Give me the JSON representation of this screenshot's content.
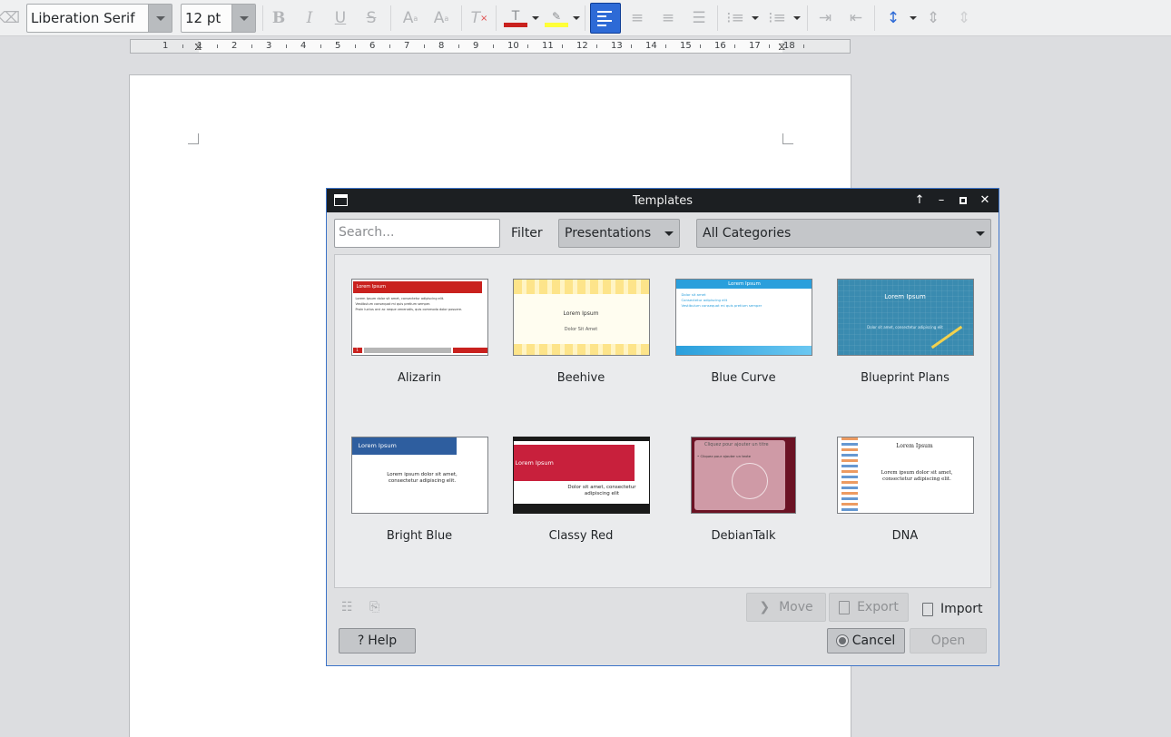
{
  "toolbar": {
    "font_name": "Liberation Serif",
    "font_size": "12 pt",
    "icons": [
      "clear-format-icon",
      "bold-icon",
      "italic-icon",
      "underline-icon",
      "strikethrough-icon",
      "superscript-icon",
      "subscript-icon",
      "clear-direct-format-icon",
      "font-color-icon",
      "highlight-color-icon",
      "align-left-icon",
      "align-center-icon",
      "align-right-icon",
      "justify-icon",
      "unordered-list-icon",
      "ordered-list-icon",
      "increase-indent-icon",
      "decrease-indent-icon",
      "line-spacing-icon",
      "paragraph-spacing-icon"
    ],
    "colors": {
      "font_color": "#c9211e",
      "highlight": "#ffff38",
      "active": "#2d6ad6"
    }
  },
  "ruler": {
    "labels": [
      "1",
      "1",
      "2",
      "3",
      "4",
      "5",
      "6",
      "7",
      "8",
      "9",
      "10",
      "11",
      "12",
      "13",
      "14",
      "15",
      "16",
      "17",
      "18"
    ]
  },
  "dialog": {
    "title": "Templates",
    "search_placeholder": "Search...",
    "filter_label": "Filter",
    "filter_value": "Presentations",
    "category_value": "All Categories",
    "templates": [
      {
        "name": "Alizarin",
        "thumb": {
          "heading": "Lorem Ipsum",
          "lines": [
            "Lorem Ipsum dolor sit amet, consectetur adipiscing elit.",
            "Vestibulum consequat mi quis pretium semper.",
            "Proin luctus orci ac neque venenatis, quis commodo dolor posuere."
          ],
          "page": "1"
        }
      },
      {
        "name": "Beehive",
        "thumb": {
          "heading": "Lorem Ipsum",
          "sub": "Dolor Sit Amet"
        }
      },
      {
        "name": "Blue Curve",
        "thumb": {
          "heading": "Lorem Ipsum",
          "lines": [
            "Dolor sit amet",
            "Consectetur adipiscing elit",
            "Vestibulum consequat mi quis pretium semper"
          ]
        }
      },
      {
        "name": "Blueprint Plans",
        "thumb": {
          "heading": "Lorem Ipsum",
          "sub": "Dolor sit amet, consectetur adipiscing elit"
        }
      },
      {
        "name": "Bright Blue",
        "thumb": {
          "heading": "Lorem Ipsum",
          "sub": "Lorem ipsum dolor sit amet, consectetur adipiscing elit."
        }
      },
      {
        "name": "Classy Red",
        "thumb": {
          "heading": "Lorem Ipsum",
          "sub": "Dolor sit amet, consectetur adipiscing elit"
        }
      },
      {
        "name": "DebianTalk",
        "thumb": {
          "heading": "Cliquez pour ajouter un titre",
          "sub": "• Cliquez pour ajouter un texte"
        }
      },
      {
        "name": "DNA",
        "thumb": {
          "heading": "Lorem Ipsum",
          "sub": "Lorem ipsum dolor sit amet, consectetur adipiscing elit."
        }
      }
    ],
    "move_label": "Move",
    "export_label": "Export",
    "import_label": "Import",
    "help_label": "Help",
    "cancel_label": "Cancel",
    "open_label": "Open"
  }
}
